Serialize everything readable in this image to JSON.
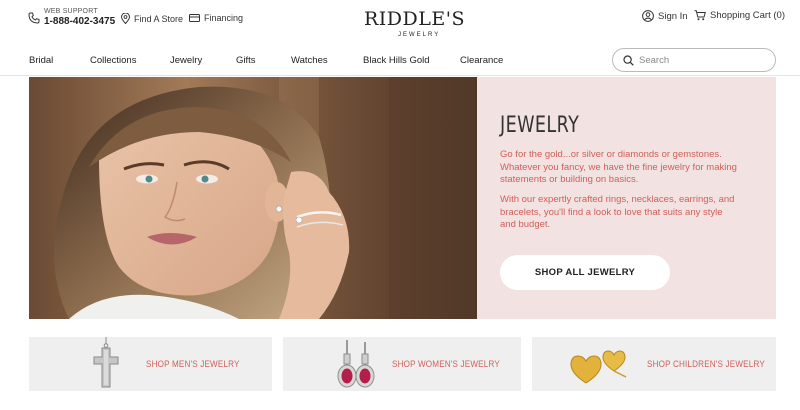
{
  "header": {
    "support_label": "WEB SUPPORT",
    "phone": "1-888-402-3475",
    "find_store": "Find A Store",
    "financing": "Financing",
    "logo_main": "RIDDLE'S",
    "logo_sub": "JEWELRY",
    "sign_in": "Sign In",
    "cart": "Shopping Cart (0)"
  },
  "nav": {
    "items": [
      "Bridal",
      "Collections",
      "Jewelry",
      "Gifts",
      "Watches",
      "Black Hills Gold",
      "Clearance"
    ],
    "search_placeholder": "Search"
  },
  "hero": {
    "title": "JEWELRY",
    "paragraph1": "Go for the gold...or silver or diamonds or gemstones. Whatever you fancy, we have the fine jewelry for making statements or building on basics.",
    "paragraph2": "With our expertly crafted rings, necklaces, earrings, and bracelets, you'll find a look to love that suits any style and budget.",
    "cta": "SHOP ALL JEWELRY",
    "accent_color": "#d0605a",
    "panel_color": "#f2e2e1"
  },
  "categories": [
    {
      "label": "SHOP MEN'S JEWELRY",
      "icon": "cross-pendant-icon"
    },
    {
      "label": "SHOP WOMEN'S JEWELRY",
      "icon": "drop-earrings-icon"
    },
    {
      "label": "SHOP CHILDREN'S JEWELRY",
      "icon": "heart-earrings-icon"
    }
  ]
}
